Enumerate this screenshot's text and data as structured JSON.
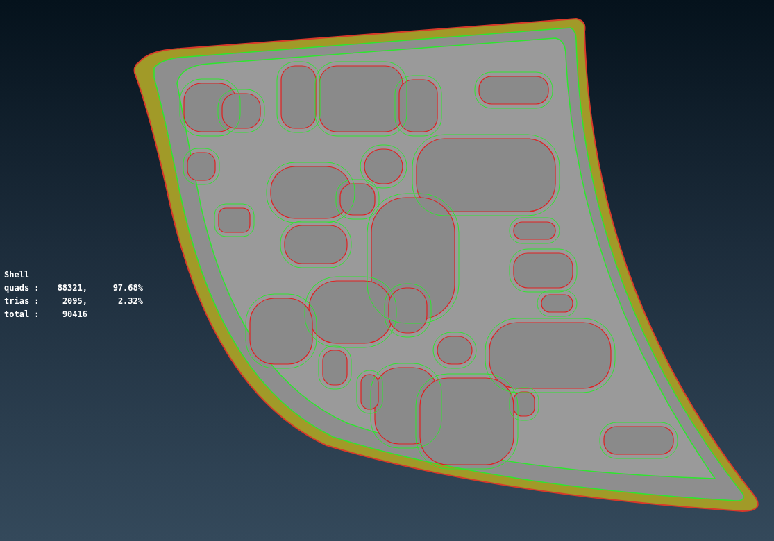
{
  "stats": {
    "title": "Shell",
    "rows": [
      {
        "label": "quads :",
        "count": "88321,",
        "percent": "97.68%"
      },
      {
        "label": "trias :",
        "count": "2095,",
        "percent": "2.32%"
      },
      {
        "label": "total :",
        "count": "90416"
      }
    ]
  }
}
